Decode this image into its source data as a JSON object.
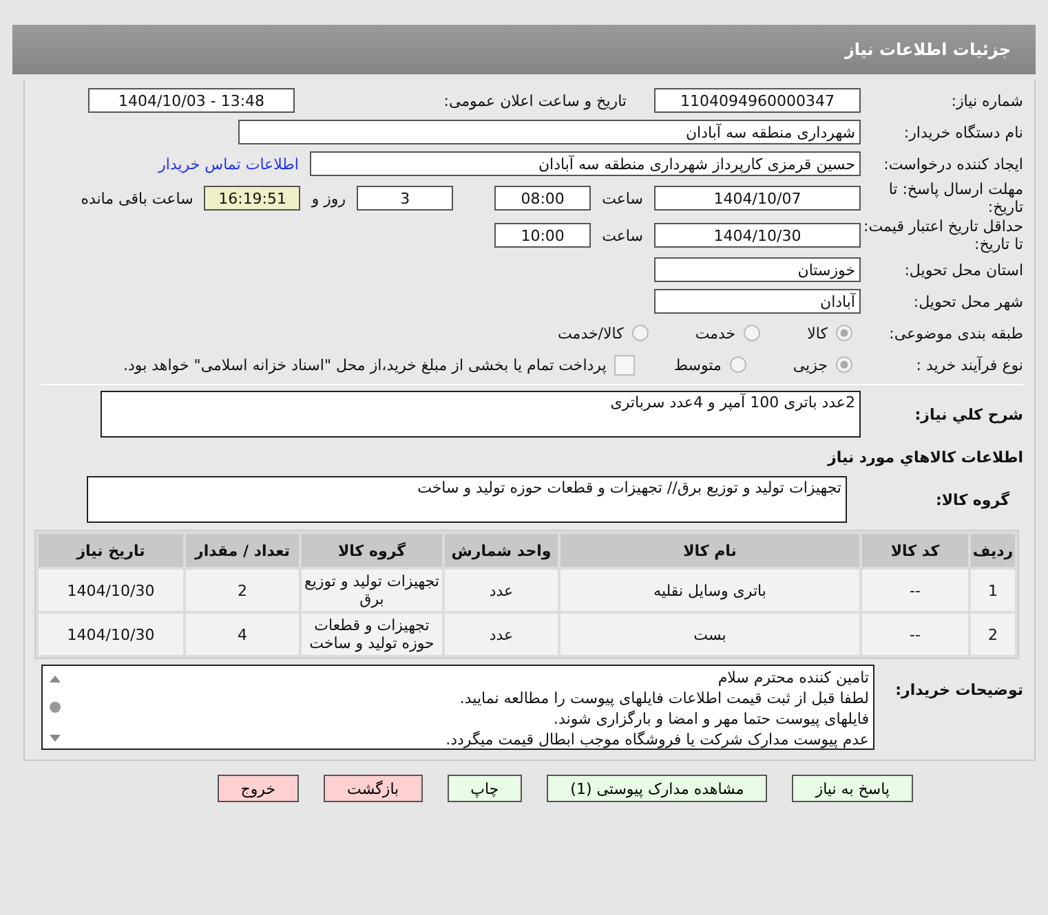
{
  "header": {
    "title": "جزئیات اطلاعات نیاز"
  },
  "need_number": {
    "label": "شماره نیاز:",
    "value": "1104094960000347"
  },
  "announce": {
    "label": "تاریخ و ساعت اعلان عمومی:",
    "value": "1404/10/03 - 13:48"
  },
  "buyer": {
    "label": "نام دستگاه خریدار:",
    "value": "شهرداری منطقه سه آبادان"
  },
  "requester": {
    "label": "ایجاد کننده درخواست:",
    "value": "حسین قرمزی کارپرداز شهرداری منطقه سه آبادان",
    "link": "اطلاعات تماس خریدار"
  },
  "deadline": {
    "label": "مهلت ارسال پاسخ: تا تاریخ:",
    "date": "1404/10/07",
    "time_label": "ساعت",
    "time": "08:00",
    "days": "3",
    "days_label": "روز و",
    "remaining": "16:19:51",
    "remaining_label": "ساعت باقی مانده"
  },
  "validity": {
    "label": "حداقل تاریخ اعتبار قیمت: تا تاریخ:",
    "date": "1404/10/30",
    "time_label": "ساعت",
    "time": "10:00"
  },
  "province": {
    "label": "استان محل تحویل:",
    "value": "خوزستان"
  },
  "city": {
    "label": "شهر محل تحویل:",
    "value": "آبادان"
  },
  "category": {
    "label": "طبقه بندی موضوعی:",
    "options": [
      {
        "label": "کالا",
        "selected": true
      },
      {
        "label": "خدمت",
        "selected": false
      },
      {
        "label": "کالا/خدمت",
        "selected": false
      }
    ]
  },
  "purchase_type": {
    "label": "نوع فرآیند خرید :",
    "options": [
      {
        "label": "جزیی",
        "selected": true
      },
      {
        "label": "متوسط",
        "selected": false
      }
    ],
    "checkbox": {
      "label": "پرداخت تمام یا بخشی از مبلغ خرید،از محل \"اسناد خزانه اسلامی\" خواهد بود.",
      "checked": false
    }
  },
  "description": {
    "label": "شرح کلي نياز:",
    "value": "2عدد باتری 100 آمپر و 4عدد سرباتری"
  },
  "goods_heading": "اطلاعات كالاهاي مورد نياز",
  "goods_group": {
    "label": "گروه کالا:",
    "value": "تجهیزات تولید و توزیع برق// تجهیزات و قطعات حوزه تولید و ساخت"
  },
  "table": {
    "columns": [
      "ردیف",
      "کد کالا",
      "نام کالا",
      "واحد شمارش",
      "گروه کالا",
      "تعداد / مقدار",
      "تاریخ نیاز"
    ],
    "rows": [
      [
        "1",
        "--",
        "باتری وسایل نقلیه",
        "عدد",
        "تجهیزات تولید و توزیع برق",
        "2",
        "1404/10/30"
      ],
      [
        "2",
        "--",
        "بست",
        "عدد",
        "تجهیزات و قطعات حوزه تولید و ساخت",
        "4",
        "1404/10/30"
      ]
    ]
  },
  "notes": {
    "label": "توضیحات خریدار:",
    "lines": [
      "تامین کننده محترم سلام",
      "لطفا قبل از ثبت قیمت اطلاعات فایلهای پیوست را مطالعه نمایید.",
      "فایلهای پیوست حتما مهر و امضا و بارگزاری شوند.",
      "عدم پیوست مدارک شرکت یا فروشگاه موجب ابطال قیمت میگردد."
    ]
  },
  "buttons": [
    {
      "label": "پاسخ به نیاز",
      "kind": "primary"
    },
    {
      "label": "مشاهده مدارک پیوستی (1)",
      "kind": "primary"
    },
    {
      "label": "چاپ",
      "kind": "primary"
    },
    {
      "label": "بازگشت",
      "kind": "danger"
    },
    {
      "label": "خروج",
      "kind": "danger"
    }
  ]
}
